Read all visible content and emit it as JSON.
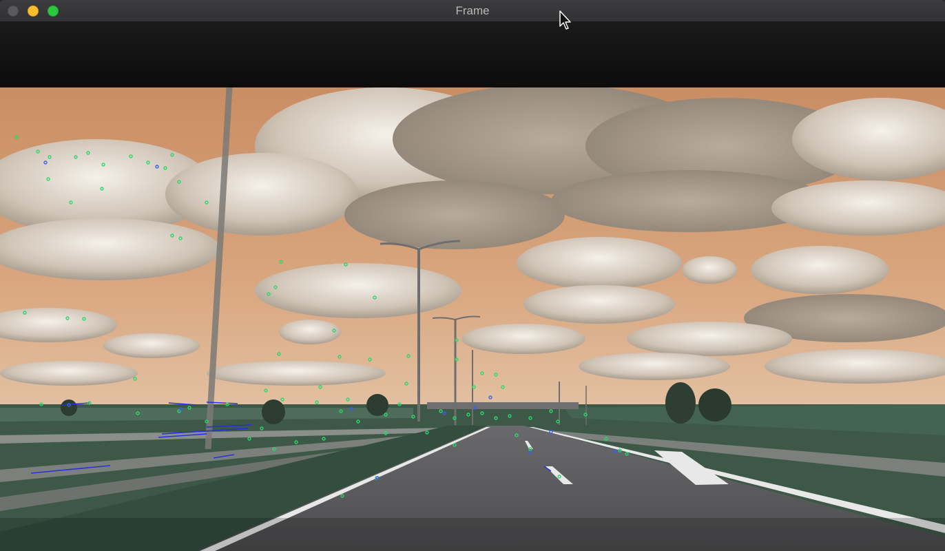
{
  "window": {
    "title": "Frame",
    "controls": [
      "close",
      "minimize",
      "maximize"
    ]
  },
  "frame": {
    "description_icon": "video-frame-icon"
  },
  "colors": {
    "sky": "#d7a57c",
    "road": "#5e5e60",
    "grass": "#3f5a4a",
    "feature_point": "#2ad86a",
    "flow_track": "#2430e0"
  }
}
